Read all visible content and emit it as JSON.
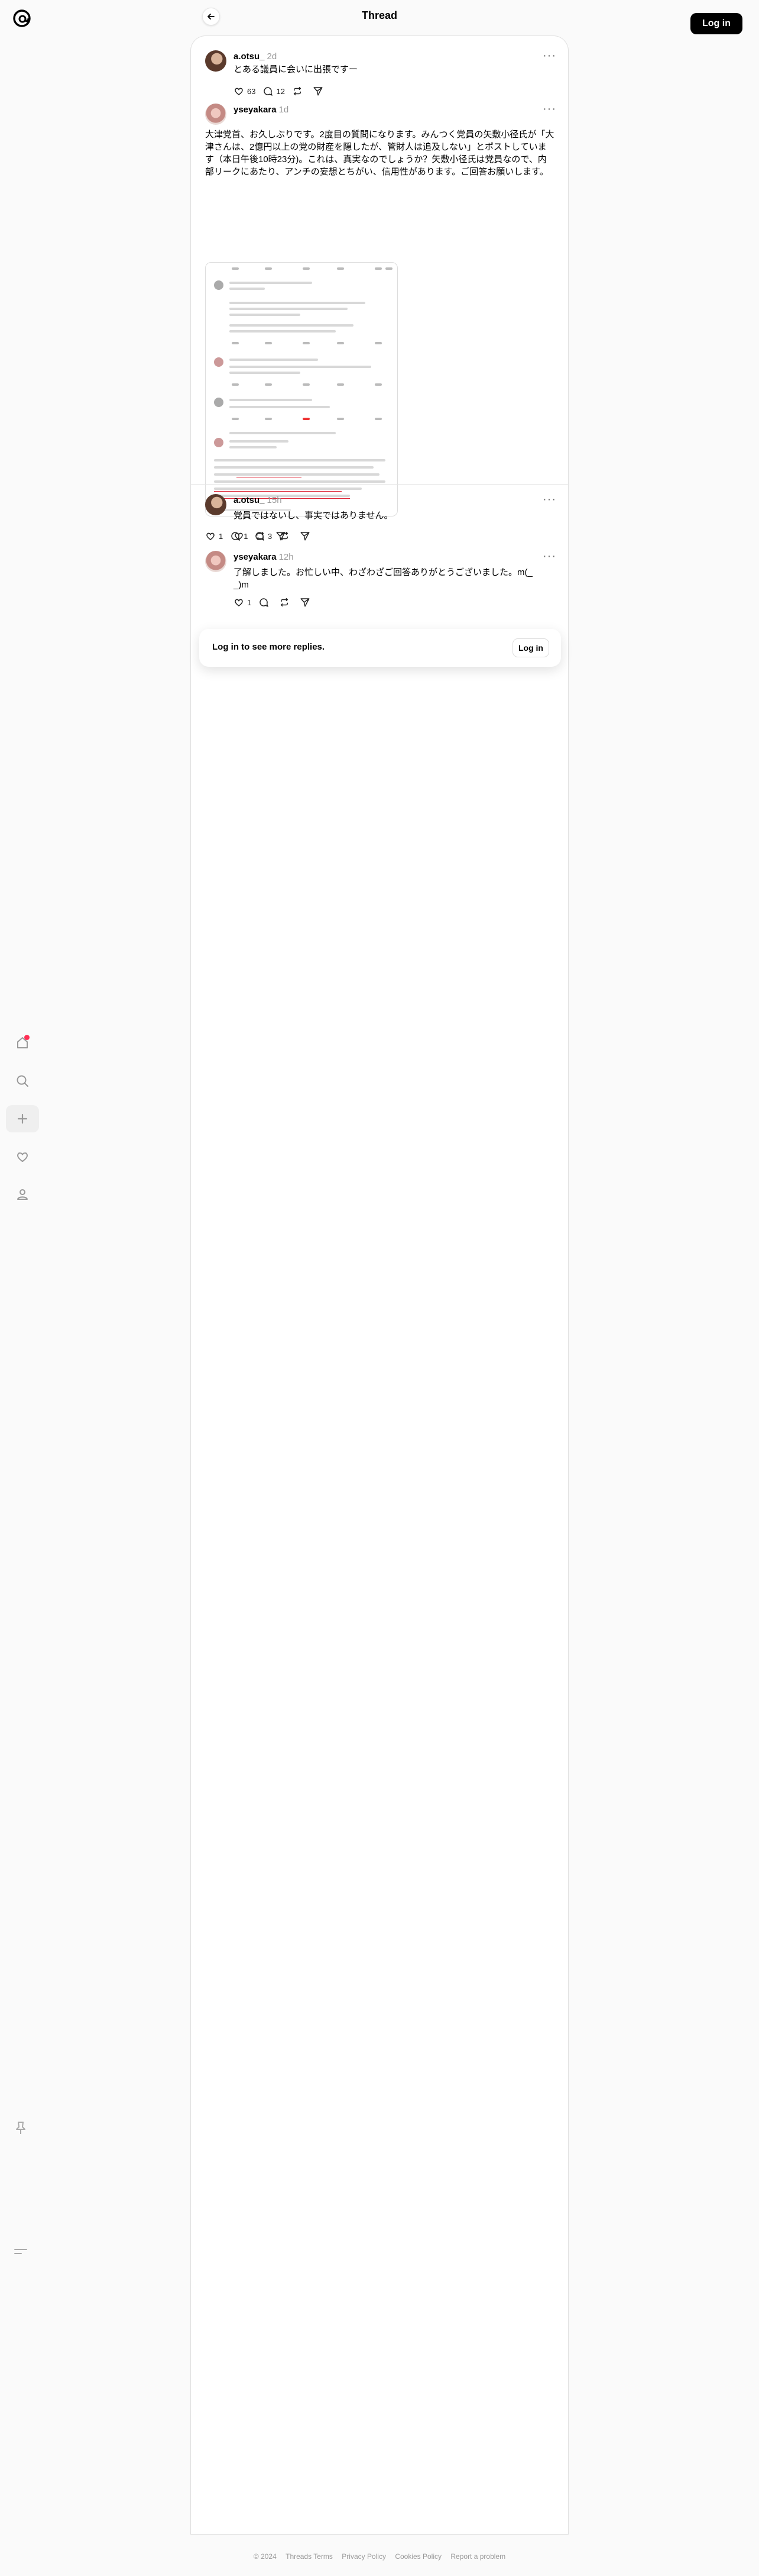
{
  "header": {
    "title": "Thread",
    "login_label": "Log in"
  },
  "posts": [
    {
      "username": "a.otsu_",
      "time": "2d",
      "text": "とある議員に会いに出張ですー",
      "likes": "63",
      "replies": "12"
    },
    {
      "username": "yseyakara",
      "time": "1d",
      "text": "大津党首、お久しぶりです。2度目の質問になります。みんつく党員の矢敷小径氏が「大津さんは、2億円以上の党の財産を隠したが、管財人は追及しない」とポストしています（本日午後10時23分)。これは、真実なのでしょうか？矢敷小径氏は党員なので、内部リークにあたり、アンチの妄想とちがい、信用性があります。ご回答お願いします。",
      "likes": "1",
      "replies": "1"
    },
    {
      "username": "a.otsu_",
      "time": "15h",
      "text": "党員ではないし、事実ではありません。",
      "likes": "",
      "replies": "3"
    },
    {
      "username": "yseyakara",
      "time": "12h",
      "text": "了解しました。お忙しい中、わざわざご回答ありがとうございました。m(_ _)m",
      "likes": "1",
      "replies": ""
    }
  ],
  "login_card": {
    "text": "Log in to see more replies.",
    "button": "Log in"
  },
  "footer": {
    "copyright": "© 2024",
    "terms": "Threads Terms",
    "privacy": "Privacy Policy",
    "cookies": "Cookies Policy",
    "report": "Report a problem"
  }
}
